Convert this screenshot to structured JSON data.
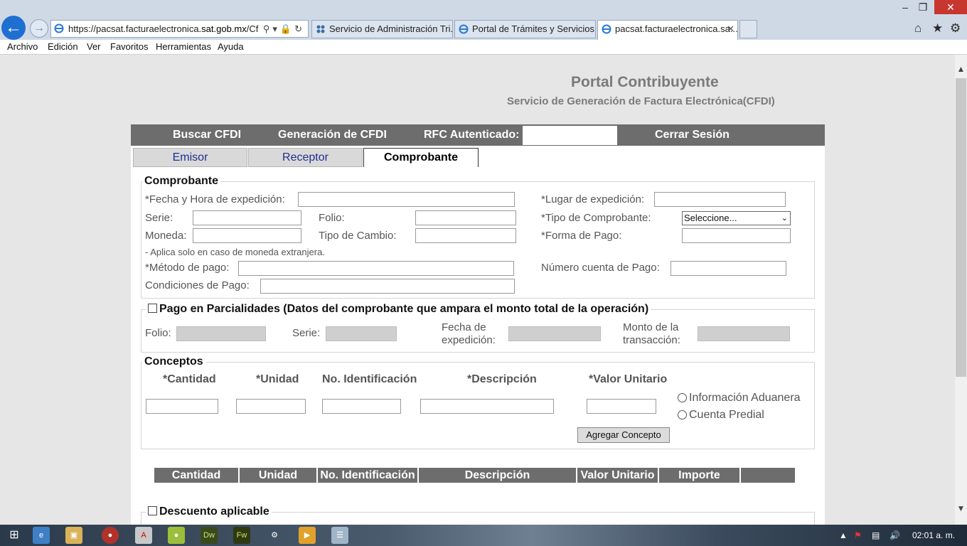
{
  "browser": {
    "address_url_prefix": "https://pacsat.facturaelectronica",
    "address_url_domain": ".sat.gob.mx",
    "address_url_suffix": "/Cfdi/I",
    "tabs": [
      {
        "label": "Servicio de Administración Tri..."
      },
      {
        "label": "Portal de Trámites y Servicios a..."
      },
      {
        "label": "pacsat.facturaelectronica.sa..."
      }
    ],
    "menu": [
      "Archivo",
      "Edición",
      "Ver",
      "Favoritos",
      "Herramientas",
      "Ayuda"
    ]
  },
  "portal": {
    "title": "Portal Contribuyente",
    "subtitle": "Servicio de Generación de Factura Electrónica(CFDI)"
  },
  "topnav": {
    "buscar": "Buscar CFDI",
    "generacion": "Generación de CFDI",
    "rfc_label": "RFC Autenticado:",
    "cerrar": "Cerrar Sesión"
  },
  "tabs": {
    "emisor": "Emisor",
    "receptor": "Receptor",
    "comprobante": "Comprobante"
  },
  "comprobante": {
    "legend": "Comprobante",
    "fecha": "*Fecha y Hora de expedición:",
    "lugar": "*Lugar de expedición:",
    "serie": "Serie:",
    "folio": "Folio:",
    "tipo_comprobante": "*Tipo de Comprobante:",
    "tipo_comprobante_value": "Seleccione...",
    "moneda": "Moneda:",
    "tipo_cambio": "Tipo de Cambio:",
    "forma_pago": "*Forma de Pago:",
    "nota_moneda": "- Aplica solo en caso de moneda extranjera.",
    "metodo_pago": "*Método de pago:",
    "numero_cuenta": "Número cuenta de Pago:",
    "condiciones": "Condiciones de Pago:"
  },
  "parcialidades": {
    "legend": "Pago en Parcialidades (Datos del comprobante que ampara el monto total de la operación)",
    "folio": "Folio:",
    "serie": "Serie:",
    "fecha_l1": "Fecha de",
    "fecha_l2": "expedición:",
    "monto_l1": "Monto de la",
    "monto_l2": "transacción:"
  },
  "conceptos": {
    "legend": "Conceptos",
    "cantidad": "*Cantidad",
    "unidad": "*Unidad",
    "no_id": "No. Identificación",
    "descripcion": "*Descripción",
    "valor_unitario": "*Valor Unitario",
    "info_aduanera": "Información Aduanera",
    "cuenta_predial": "Cuenta Predial",
    "agregar": "Agregar Concepto"
  },
  "tabla": {
    "headers": [
      "Cantidad",
      "Unidad",
      "No. Identificación",
      "Descripción",
      "Valor Unitario",
      "Importe",
      ""
    ]
  },
  "descuento": {
    "legend": "Descuento aplicable"
  },
  "taskbar": {
    "clock": "02:01 a. m."
  }
}
